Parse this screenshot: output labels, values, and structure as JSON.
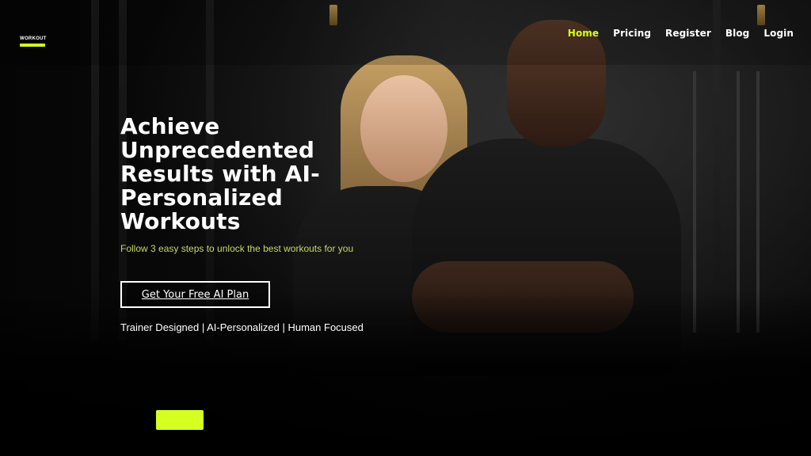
{
  "brand": {
    "name": "WORKOUT",
    "accent_color": "#d7ff1f"
  },
  "nav": {
    "items": [
      {
        "label": "Home",
        "active": true
      },
      {
        "label": "Pricing",
        "active": false
      },
      {
        "label": "Register",
        "active": false
      },
      {
        "label": "Blog",
        "active": false
      },
      {
        "label": "Login",
        "active": false
      }
    ]
  },
  "hero": {
    "title": "Achieve Unprecedented Results with AI-Personalized Workouts",
    "subtitle": "Follow 3 easy steps to unlock the best workouts for you",
    "cta_label": "Get Your Free AI Plan",
    "tagline": "Trainer Designed | AI-Personalized | Human Focused"
  },
  "theme": {
    "background": "#050505",
    "text": "#ffffff",
    "subtitle_color": "#c6d86a"
  }
}
